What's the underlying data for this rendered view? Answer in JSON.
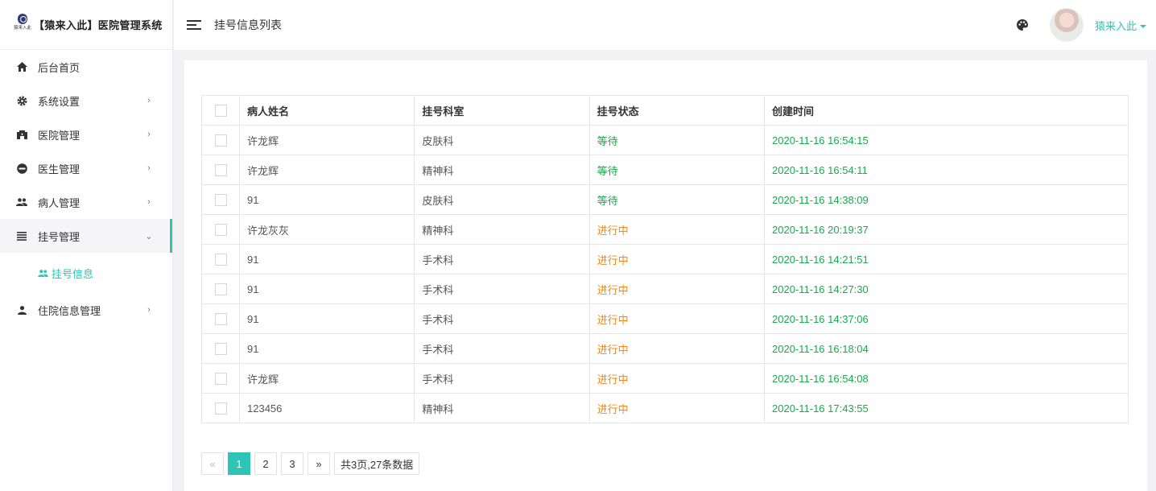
{
  "brand": {
    "logo_text": "猿来入此",
    "title": "【猿来入此】医院管理系统"
  },
  "sidebar": {
    "items": [
      {
        "label": "后台首页",
        "icon": "home-icon",
        "has_arrow": false
      },
      {
        "label": "系统设置",
        "icon": "gear-icon",
        "has_arrow": true
      },
      {
        "label": "医院管理",
        "icon": "hospital-icon",
        "has_arrow": true
      },
      {
        "label": "医生管理",
        "icon": "doctor-icon",
        "has_arrow": true
      },
      {
        "label": "病人管理",
        "icon": "people-icon",
        "has_arrow": true
      },
      {
        "label": "挂号管理",
        "icon": "list-icon",
        "has_arrow": true,
        "expanded": true
      },
      {
        "label": "住院信息管理",
        "icon": "person-icon",
        "has_arrow": true
      }
    ],
    "subitem": {
      "label": "挂号信息",
      "icon": "people-icon"
    }
  },
  "header": {
    "title": "挂号信息列表",
    "user_name": "猿来入此"
  },
  "table": {
    "columns": [
      "病人姓名",
      "挂号科室",
      "挂号状态",
      "创建时间"
    ],
    "rows": [
      {
        "name": "许龙辉",
        "dept": "皮肤科",
        "status": "等待",
        "time": "2020-11-16 16:54:15"
      },
      {
        "name": "许龙辉",
        "dept": "精神科",
        "status": "等待",
        "time": "2020-11-16 16:54:11"
      },
      {
        "name": "91",
        "dept": "皮肤科",
        "status": "等待",
        "time": "2020-11-16 14:38:09"
      },
      {
        "name": "许龙灰灰",
        "dept": "精神科",
        "status": "进行中",
        "time": "2020-11-16 20:19:37"
      },
      {
        "name": "91",
        "dept": "手术科",
        "status": "进行中",
        "time": "2020-11-16 14:21:51"
      },
      {
        "name": "91",
        "dept": "手术科",
        "status": "进行中",
        "time": "2020-11-16 14:27:30"
      },
      {
        "name": "91",
        "dept": "手术科",
        "status": "进行中",
        "time": "2020-11-16 14:37:06"
      },
      {
        "name": "91",
        "dept": "手术科",
        "status": "进行中",
        "time": "2020-11-16 16:18:04"
      },
      {
        "name": "许龙辉",
        "dept": "手术科",
        "status": "进行中",
        "time": "2020-11-16 16:54:08"
      },
      {
        "name": "123456",
        "dept": "精神科",
        "status": "进行中",
        "time": "2020-11-16 17:43:55"
      }
    ]
  },
  "pagination": {
    "prev": "«",
    "next": "»",
    "pages": [
      "1",
      "2",
      "3"
    ],
    "current": "1",
    "info": "共3页,27条数据"
  },
  "colors": {
    "accent": "#2ec4b6",
    "wait": "#1aa94c",
    "going": "#f0891c"
  }
}
